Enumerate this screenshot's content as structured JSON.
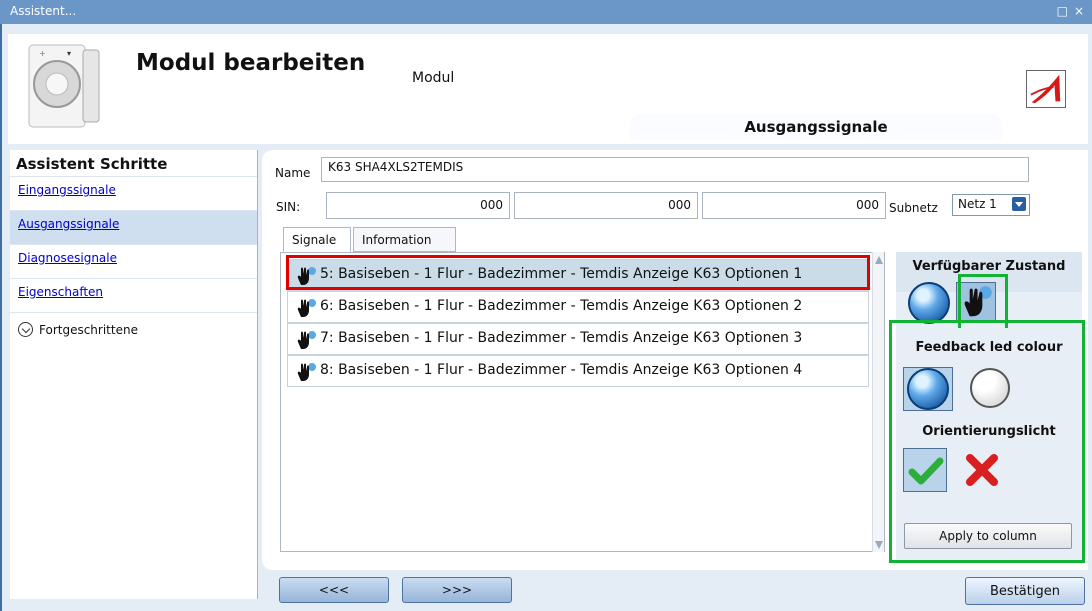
{
  "window": {
    "title": "Assistent...",
    "controls": [
      "□",
      "×"
    ]
  },
  "header": {
    "heading": "Modul bearbeiten",
    "subtitle": "Modul",
    "output_tab": "Ausgangssignale"
  },
  "sidebar": {
    "title": "Assistent Schritte",
    "items": [
      {
        "label": "Eingangssignale"
      },
      {
        "label": "Ausgangssignale",
        "active": true
      },
      {
        "label": "Diagnosesignale"
      },
      {
        "label": "Eigenschaften"
      }
    ],
    "advanced": {
      "label": "Fortgeschrittene"
    }
  },
  "form": {
    "name_label": "Name",
    "name_value": "K63 SHA4XLS2TEMDIS",
    "sin_label": "SIN:",
    "sin_values": [
      "000",
      "000",
      "000"
    ],
    "subnet_label": "Subnetz",
    "subnet_value": "Netz 1"
  },
  "tabs": [
    {
      "label": "Signale",
      "active": true
    },
    {
      "label": "Information"
    }
  ],
  "signals": [
    {
      "label": "5: Basiseben - 1 Flur - Badezimmer - Temdis Anzeige K63 Optionen 1",
      "selected": true
    },
    {
      "label": "6: Basiseben - 1 Flur - Badezimmer - Temdis Anzeige K63 Optionen 2"
    },
    {
      "label": "7: Basiseben - 1 Flur - Badezimmer - Temdis Anzeige K63 Optionen 3"
    },
    {
      "label": "8: Basiseben - 1 Flur - Badezimmer - Temdis Anzeige K63 Optionen 4"
    }
  ],
  "right_panel": {
    "state_title": "Verfügbarer Zustand",
    "led_title": "Feedback led colour",
    "orient_title": "Orientierungslicht",
    "apply_label": "Apply to column"
  },
  "nav": {
    "prev": "<<<",
    "next": ">>>",
    "confirm": "Bestätigen"
  },
  "colors": {
    "accent": "#6b97c8",
    "highlight_red": "#e00000",
    "highlight_green": "#12b334",
    "selected_row": "#c9dce7"
  }
}
